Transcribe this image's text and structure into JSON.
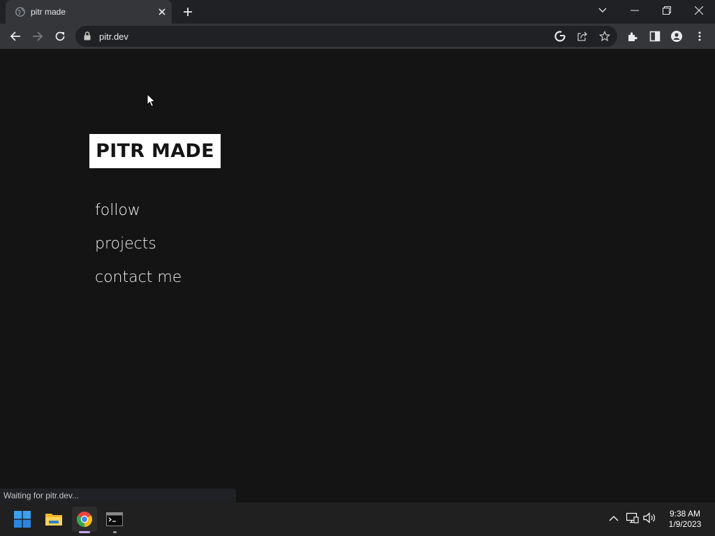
{
  "browser": {
    "tab_title": "pitr made",
    "url": "pitr.dev"
  },
  "page": {
    "logo": "PITR MADE",
    "nav": [
      {
        "label": "follow"
      },
      {
        "label": "projects"
      },
      {
        "label": "contact me"
      }
    ]
  },
  "status_bar": {
    "text": "Waiting for pitr.dev..."
  },
  "taskbar": {
    "time": "9:38 AM",
    "date": "1/9/2023"
  },
  "icons": [
    "globe-icon",
    "close-icon",
    "plus-icon",
    "chevron-down-icon",
    "minimize-icon",
    "restore-icon",
    "back-icon",
    "forward-icon",
    "reload-icon",
    "lock-icon",
    "google-icon",
    "share-icon",
    "star-icon",
    "extensions-icon",
    "side-panel-icon",
    "profile-icon",
    "menu-icon",
    "windows-start-icon",
    "file-explorer-icon",
    "chrome-icon",
    "terminal-icon",
    "tray-chevron-icon",
    "network-icon",
    "volume-icon",
    "cursor-icon"
  ]
}
